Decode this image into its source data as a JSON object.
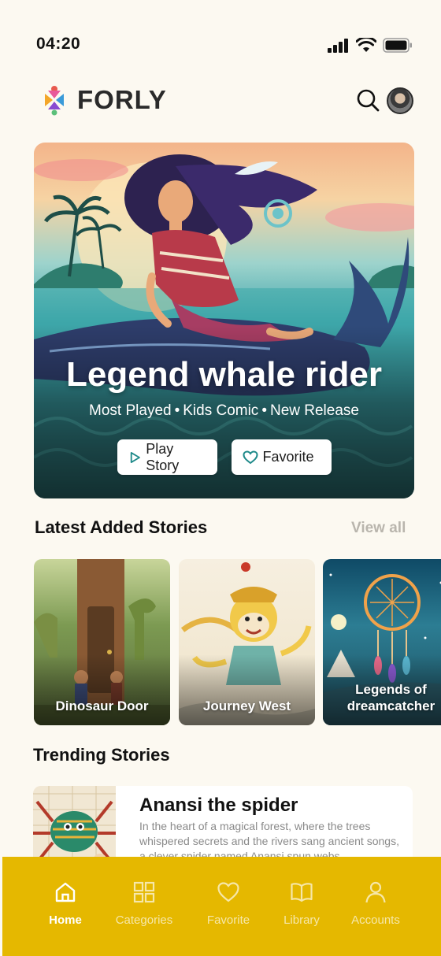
{
  "status_bar": {
    "time": "04:20"
  },
  "app": {
    "name": "FORLY"
  },
  "hero": {
    "title": "Legend whale rider",
    "tags": [
      "Most Played",
      "Kids Comic",
      "New Release"
    ],
    "tag_separator": "•",
    "play_label": "Play Story",
    "favorite_label": "Favorite"
  },
  "latest": {
    "title": "Latest Added Stories",
    "view_all": "View all",
    "items": [
      {
        "label": "Dinosaur Door"
      },
      {
        "label": "Journey West"
      },
      {
        "label": "Legends of dreamcatcher"
      }
    ]
  },
  "trending": {
    "title": "Trending Stories",
    "items": [
      {
        "title": "Anansi the spider",
        "description": "In the heart of a magical forest, where the trees whispered secrets and the rivers sang ancient songs, a clever spider named Anansi spun webs"
      }
    ]
  },
  "nav": {
    "items": [
      {
        "label": "Home",
        "icon": "home-icon",
        "active": true
      },
      {
        "label": "Categories",
        "icon": "grid-icon",
        "active": false
      },
      {
        "label": "Favorite",
        "icon": "heart-icon",
        "active": false
      },
      {
        "label": "Library",
        "icon": "book-icon",
        "active": false
      },
      {
        "label": "Accounts",
        "icon": "user-icon",
        "active": false
      }
    ]
  },
  "colors": {
    "background": "#fcf9f1",
    "nav_background": "#e5b800",
    "muted_text": "#b9b5ad"
  }
}
